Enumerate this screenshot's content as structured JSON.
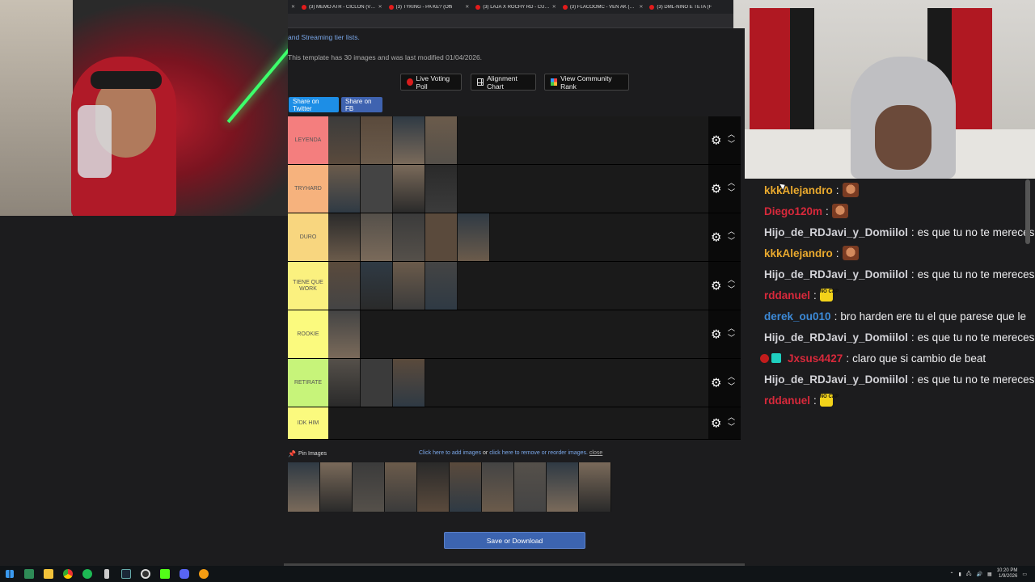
{
  "browser": {
    "tabs": [
      {
        "title": "(3) MEMO ATR - CICLON (Video"
      },
      {
        "title": "(3) TYKING - PA KE? (Offi"
      },
      {
        "title": "(3) LAJA X ROCHY RD - CUELN"
      },
      {
        "title": "(3) FLACOOMC - VEN AK (VIDE"
      },
      {
        "title": "(3) DML-NIÑO E TETA (F"
      }
    ]
  },
  "page": {
    "note_link": "and Streaming tier lists.",
    "template_info": "This template has 30 images and was last modified 01/04/2026.",
    "buttons": {
      "live": "Live Voting Poll",
      "align": "Alignment Chart",
      "rank": "View Community Rank",
      "twitter": "Share on Twitter",
      "fb": "Share on FB",
      "save": "Save or Download"
    },
    "tiers": [
      {
        "label": "LEYENDA",
        "color": "#f47e7e",
        "count": 4
      },
      {
        "label": "TRYHARD",
        "color": "#f6b27d",
        "count": 4
      },
      {
        "label": "DURO",
        "color": "#f8d67f",
        "count": 5
      },
      {
        "label": "TIENE QUE WORK",
        "color": "#fbf17f",
        "count": 4
      },
      {
        "label": "ROOKIE",
        "color": "#fbfa7e",
        "count": 1
      },
      {
        "label": "RETIRATE",
        "color": "#c7f47a",
        "count": 3
      },
      {
        "label": "IDK HIM",
        "color": "#fbfa7e",
        "count": 0
      }
    ],
    "pin_label": "Pin Images",
    "add_images": "Click here to add images",
    "or": "or",
    "remove_images": "click here to remove or reorder images.",
    "close": "close",
    "pool_count": 10
  },
  "chat": [
    {
      "user": "kkkAlejandro",
      "color": "#e9a92e",
      "text": "",
      "emote": "face"
    },
    {
      "user": "Diego120m",
      "color": "#d8293b",
      "text": "",
      "emote": "face"
    },
    {
      "user": "Hijo_de_RDJavi_y_Domiilol",
      "color": "#d3d3d8",
      "text": "es que tu no te mereces"
    },
    {
      "user": "kkkAlejandro",
      "color": "#e9a92e",
      "text": "",
      "emote": "face"
    },
    {
      "user": "Hijo_de_RDJavi_y_Domiilol",
      "color": "#d3d3d8",
      "text": "es que tu no te mereces"
    },
    {
      "user": "rddanuel",
      "color": "#d8293b",
      "text": "",
      "emote": "nocap"
    },
    {
      "user": "derek_ou010",
      "color": "#3c8ad8",
      "text": "bro harden ere tu el que parese que le"
    },
    {
      "user": "Hijo_de_RDJavi_y_Domiilol",
      "color": "#d3d3d8",
      "text": "es que tu no te mereces"
    },
    {
      "user": "Jxsus4427",
      "color": "#d8293b",
      "text": "claro que si cambio de beat",
      "badges": true
    },
    {
      "user": "Hijo_de_RDJavi_y_Domiilol",
      "color": "#d3d3d8",
      "text": "es que tu no te mereces"
    },
    {
      "user": "rddanuel",
      "color": "#d8293b",
      "text": "",
      "emote": "nocap"
    }
  ],
  "emote_text": {
    "nocap": "NO CAP"
  },
  "taskbar": {
    "time": "10:20 PM",
    "date": "1/9/2026"
  }
}
